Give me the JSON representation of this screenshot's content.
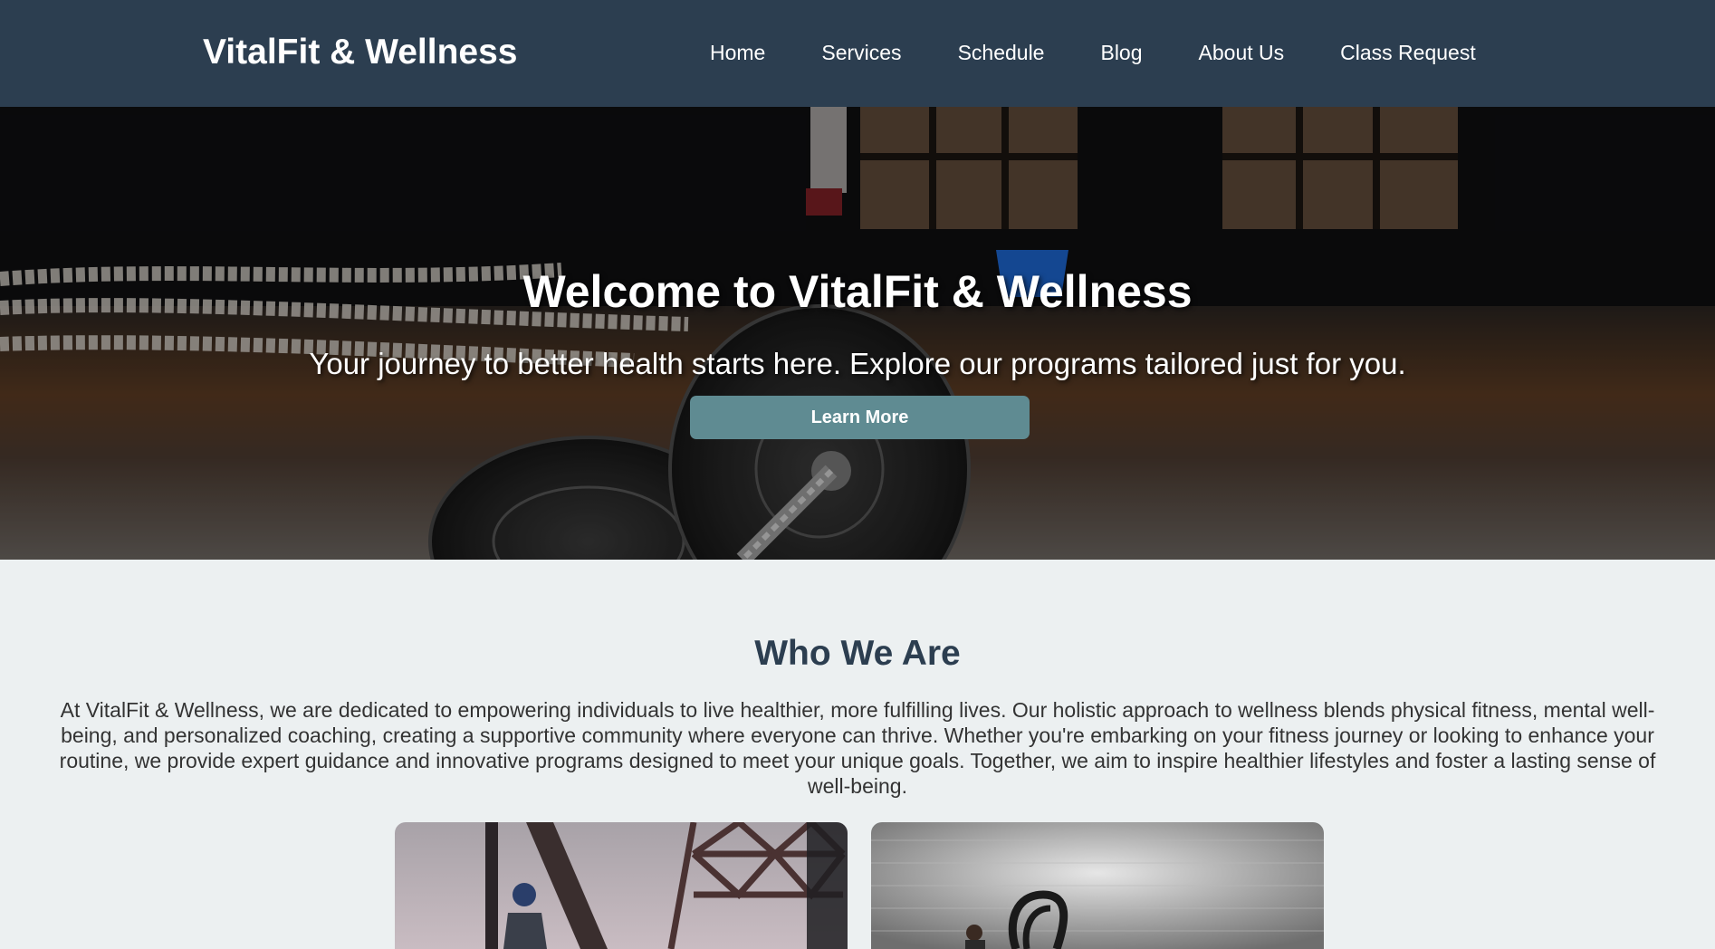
{
  "nav": {
    "brand": "VitalFit & Wellness",
    "links": [
      "Home",
      "Services",
      "Schedule",
      "Blog",
      "About Us",
      "Class Request"
    ]
  },
  "hero": {
    "title": "Welcome to VitalFit & Wellness",
    "subtitle": "Your journey to better health starts here. Explore our programs tailored just for you.",
    "button_label": "Learn More"
  },
  "about": {
    "title": "Who We Are",
    "text": "At VitalFit & Wellness, we are dedicated to empowering individuals to live healthier, more fulfilling lives. Our holistic approach to wellness blends physical fitness, mental well-being, and personalized coaching, creating a supportive community where everyone can thrive. Whether you're embarking on your fitness journey or looking to enhance your routine, we provide expert guidance and innovative programs designed to meet your unique goals. Together, we aim to inspire healthier lifestyles and foster a lasting sense of well-being."
  },
  "colors": {
    "nav_bg": "#2c3e50",
    "page_bg": "#ecf0f1",
    "accent": "#5f8b92",
    "heading": "#2c3e50"
  }
}
